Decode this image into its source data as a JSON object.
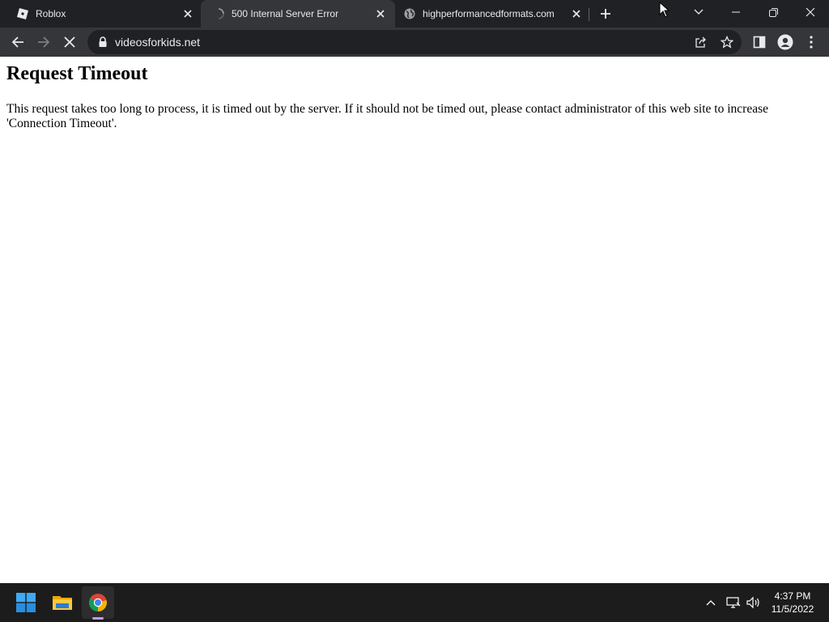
{
  "tabs": [
    {
      "title": "Roblox",
      "icon": "roblox-icon",
      "active": false
    },
    {
      "title": "500 Internal Server Error",
      "icon": "loading-spinner-icon",
      "active": true
    },
    {
      "title": "highperformancedformats.com",
      "icon": "globe-icon",
      "active": false
    }
  ],
  "toolbar": {
    "url": "videosforkids.net"
  },
  "page": {
    "heading": "Request Timeout",
    "message": "This request takes too long to process, it is timed out by the server. If it should not be timed out, please contact administrator of this web site to increase 'Connection Timeout'."
  },
  "taskbar": {
    "time": "4:37 PM",
    "date": "11/5/2022",
    "apps": [
      "start-icon",
      "file-explorer-icon",
      "chrome-icon"
    ]
  },
  "colors": {
    "tabstrip": "#202124",
    "toolbar": "#35363a",
    "taskbar": "#1c1c1c",
    "text_light": "#e8eaed"
  }
}
